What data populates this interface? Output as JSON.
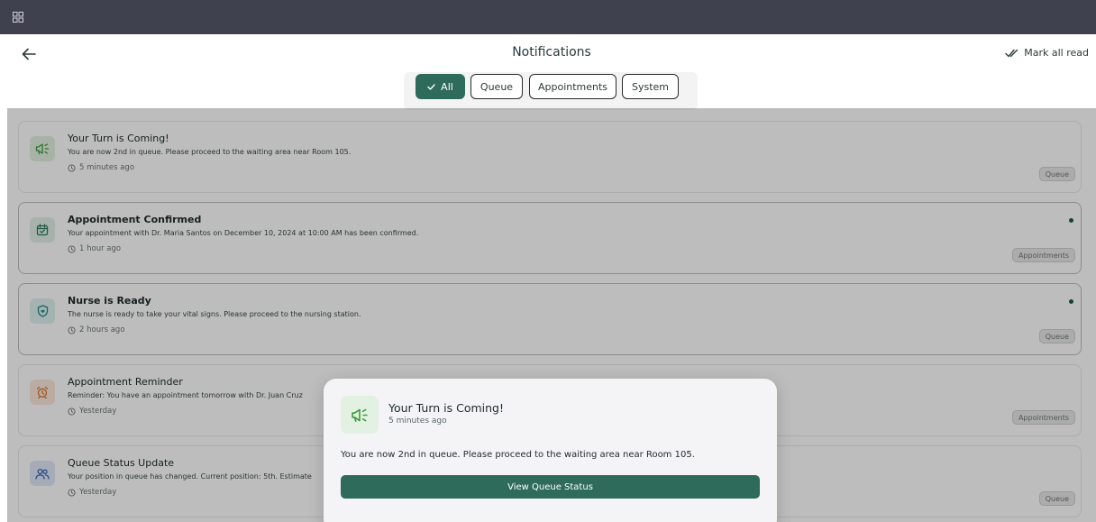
{
  "header": {
    "title": "Notifications",
    "mark_all_label": "Mark all read"
  },
  "filters": [
    {
      "label": "All",
      "active": true
    },
    {
      "label": "Queue",
      "active": false
    },
    {
      "label": "Appointments",
      "active": false
    },
    {
      "label": "System",
      "active": false
    }
  ],
  "notifications": [
    {
      "title": "Your Turn is Coming!",
      "message": "You are now 2nd in queue. Please proceed to the waiting area near Room 105.",
      "time": "5 minutes ago",
      "tag": "Queue",
      "unread": false,
      "icon": "megaphone-icon"
    },
    {
      "title": "Appointment Confirmed",
      "message": "Your appointment with Dr. Maria Santos on December 10, 2024 at 10:00 AM has been confirmed.",
      "time": "1 hour ago",
      "tag": "Appointments",
      "unread": true,
      "icon": "calendar-check-icon"
    },
    {
      "title": "Nurse is Ready",
      "message": "The nurse is ready to take your vital signs. Please proceed to the nursing station.",
      "time": "2 hours ago",
      "tag": "Queue",
      "unread": true,
      "icon": "shield-heart-icon"
    },
    {
      "title": "Appointment Reminder",
      "message": "Reminder: You have an appointment tomorrow with Dr. Juan Cruz",
      "time": "Yesterday",
      "tag": "Appointments",
      "unread": false,
      "icon": "alarm-clock-icon"
    },
    {
      "title": "Queue Status Update",
      "message": "Your position in queue has changed. Current position: 5th. Estimate",
      "time": "Yesterday",
      "tag": "Queue",
      "unread": false,
      "icon": "users-icon"
    }
  ],
  "dialog": {
    "title": "Your Turn is Coming!",
    "time": "5 minutes ago",
    "message": "You are now 2nd in queue. Please proceed to the waiting area near Room 105.",
    "button_label": "View Queue Status"
  },
  "colors": {
    "accent": "#2f6b5b",
    "topbar": "#40414f",
    "unread_dot": "#1f5a49"
  }
}
